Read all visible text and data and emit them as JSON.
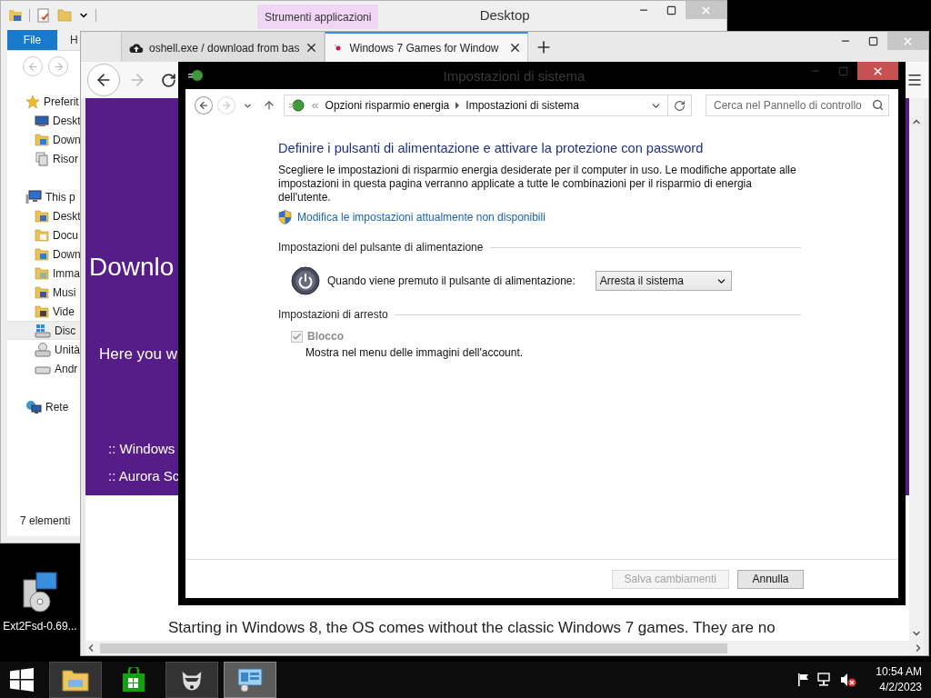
{
  "explorer": {
    "context_tab": "Strumenti applicazioni",
    "title": "Desktop",
    "ribbon_tabs": [
      {
        "label": "File",
        "selected": true
      },
      {
        "label": "H",
        "selected": false
      }
    ],
    "nav": [
      {
        "label": "Preferit",
        "kind": "star",
        "selected": false,
        "children": [
          {
            "label": "Deskt",
            "kind": "monitor",
            "selected": false
          },
          {
            "label": "Down",
            "kind": "downloads",
            "selected": false
          },
          {
            "label": "Risor",
            "kind": "recent",
            "selected": false
          }
        ]
      },
      {
        "label": "This p",
        "kind": "pc",
        "selected": false,
        "children": [
          {
            "label": "Deskt",
            "kind": "desktop",
            "selected": false
          },
          {
            "label": "Docu",
            "kind": "documents",
            "selected": false
          },
          {
            "label": "Down",
            "kind": "downloads",
            "selected": false
          },
          {
            "label": "Imma",
            "kind": "pictures",
            "selected": false
          },
          {
            "label": "Musi",
            "kind": "music",
            "selected": false
          },
          {
            "label": "Vide",
            "kind": "videos",
            "selected": false
          },
          {
            "label": "Disc",
            "kind": "system-drive",
            "selected": true
          },
          {
            "label": "Unità",
            "kind": "dvd",
            "selected": false
          },
          {
            "label": "Andr",
            "kind": "drive",
            "selected": false
          }
        ]
      },
      {
        "label": "Rete",
        "kind": "network",
        "selected": false
      }
    ],
    "status": "7 elementi"
  },
  "desktop_icons": [
    {
      "label": "Ext2Fsd-0.69..."
    }
  ],
  "browser": {
    "tabs": [
      {
        "title": "oshell.exe / download from bas",
        "kind": "cloud",
        "selected": false
      },
      {
        "title": "Windows 7 Games for Window",
        "kind": "site",
        "selected": true
      }
    ],
    "banner": {
      "heading": "Downlo",
      "lead": "Here you w",
      "links": [
        ":: Windows",
        ":: Aurora Sc"
      ]
    },
    "body_text": "Starting in Windows 8, the OS comes without the classic Windows 7 games. They are no"
  },
  "dialog": {
    "title": "Impostazioni di sistema",
    "breadcrumb": [
      "Opzioni risparmio energia",
      "Impostazioni di sistema"
    ],
    "search_placeholder": "Cerca nel Pannello di controllo",
    "heading": "Definire i pulsanti di alimentazione e attivare la protezione con password",
    "description": "Scegliere le impostazioni di risparmio energia desiderate per il computer in uso. Le modifiche apportate alle impostazioni in questa pagina verranno applicate a tutte le combinazioni per il risparmio di energia dell'utente.",
    "admin_link": "Modifica le impostazioni attualmente non disponibili",
    "sections": [
      {
        "title": "Impostazioni del pulsante di alimentazione",
        "kind": "power",
        "label": "Quando viene premuto il pulsante di alimentazione:",
        "value": "Arresta il sistema"
      },
      {
        "title": "Impostazioni di arresto",
        "kind": "checkbox",
        "label": "Blocco",
        "checked": true,
        "disabled": true,
        "description": "Mostra nel menu delle immagini dell'account."
      }
    ],
    "buttons": [
      {
        "label": "Salva cambiamenti",
        "disabled": true
      },
      {
        "label": "Annulla",
        "disabled": false
      }
    ]
  },
  "taskbar": {
    "apps": [
      {
        "kind": "explorer",
        "running": true,
        "selected": false
      },
      {
        "kind": "store",
        "running": false,
        "selected": false
      },
      {
        "kind": "raccoon",
        "running": true,
        "selected": false
      },
      {
        "kind": "control-panel",
        "running": true,
        "selected": true
      }
    ],
    "tray": {
      "muted": true,
      "time": "10:54 AM",
      "date": "4/2/2023"
    }
  }
}
